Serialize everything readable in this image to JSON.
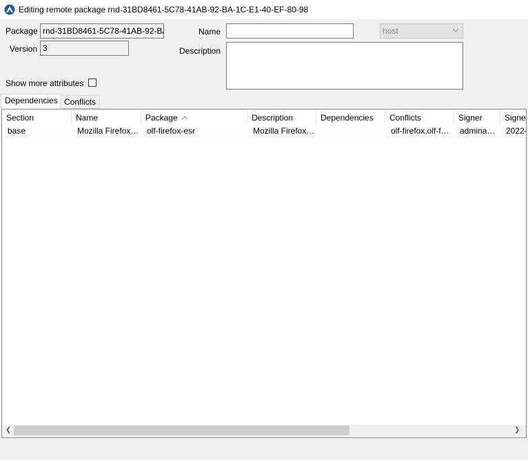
{
  "window": {
    "title": "Editing remote package rnd-31BD8461-5C78-41AB-92-BA-1C-E1-40-EF-80-98"
  },
  "form": {
    "package_label": "Package",
    "package_value": "rnd-31BD8461-5C78-41AB-92-BA",
    "version_label": "Version",
    "version_value": "3",
    "name_label": "Name",
    "name_value": "",
    "host_value": "host",
    "description_label": "Description",
    "description_value": "",
    "show_more_label": "Show more attributes",
    "show_more_checked": false
  },
  "tabs": [
    {
      "label": "Dependencies",
      "active": true
    },
    {
      "label": "Conflicts",
      "active": false
    }
  ],
  "table": {
    "columns": [
      "Section",
      "Name",
      "Package",
      "Description",
      "Dependencies",
      "Conflicts",
      "Signer",
      "Signe"
    ],
    "sort_column": "Package",
    "rows": [
      {
        "section": "base",
        "name": "Mozilla Firefox…",
        "package": "olf-firefox-esr",
        "description": "Mozilla Firefox…",
        "dependencies": "",
        "conflicts": "olf-firefox,olf-f…",
        "signer": "admina…",
        "signed": "2022-"
      }
    ]
  },
  "colors": {
    "highlight": "#fff200",
    "accent": "#0a4f9e"
  }
}
